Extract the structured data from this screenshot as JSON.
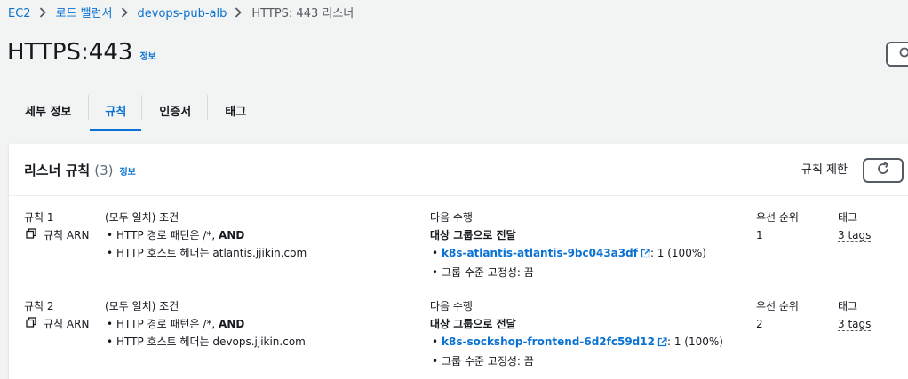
{
  "breadcrumb": {
    "items": [
      "EC2",
      "로드 밸런서",
      "devops-pub-alb"
    ],
    "current": "HTTPS: 443 리스너"
  },
  "page": {
    "title": "HTTPS:443",
    "info": "정보"
  },
  "tabs": [
    {
      "label": "세부 정보",
      "active": false
    },
    {
      "label": "규칙",
      "active": true
    },
    {
      "label": "인증서",
      "active": false
    },
    {
      "label": "태그",
      "active": false
    }
  ],
  "panel": {
    "title": "리스너 규칙",
    "count": "(3)",
    "info": "정보",
    "limit_link": "규칙 제한"
  },
  "rules": [
    {
      "name": "규칙 1",
      "arn_label": "규칙 ARN",
      "conditions_title": "(모두 일치) 조건",
      "conditions": [
        {
          "prefix": "HTTP 경로 패턴은 /*, ",
          "bold": "AND"
        },
        {
          "prefix": "HTTP 호스트 헤더는 atlantis.jjikin.com",
          "bold": ""
        }
      ],
      "action_title": "다음 수행",
      "action_type": "대상 그룹으로 전달",
      "target_group": "k8s-atlantis-atlantis-9bc043a3df",
      "target_weight": ": 1 (100%)",
      "stickiness": "그룹 수준 고정성: 끔",
      "priority_label": "우선 순위",
      "priority": "1",
      "tags_label": "태그",
      "tags": "3 tags"
    },
    {
      "name": "규칙 2",
      "arn_label": "규칙 ARN",
      "conditions_title": "(모두 일치) 조건",
      "conditions": [
        {
          "prefix": "HTTP 경로 패턴은 /*, ",
          "bold": "AND"
        },
        {
          "prefix": "HTTP 호스트 헤더는 devops.jjikin.com",
          "bold": ""
        }
      ],
      "action_title": "다음 수행",
      "action_type": "대상 그룹으로 전달",
      "target_group": "k8s-sockshop-frontend-6d2fc59d12",
      "target_weight": ": 1 (100%)",
      "stickiness": "그룹 수준 고정성: 끔",
      "priority_label": "우선 순위",
      "priority": "2",
      "tags_label": "태그",
      "tags": "3 tags"
    }
  ],
  "colors": {
    "link": "#0972d3",
    "background": "#f2f3f3",
    "text": "#16191f"
  },
  "icons": [
    "chevron-right-icon",
    "search-icon",
    "refresh-icon",
    "copy-icon",
    "external-link-icon"
  ]
}
